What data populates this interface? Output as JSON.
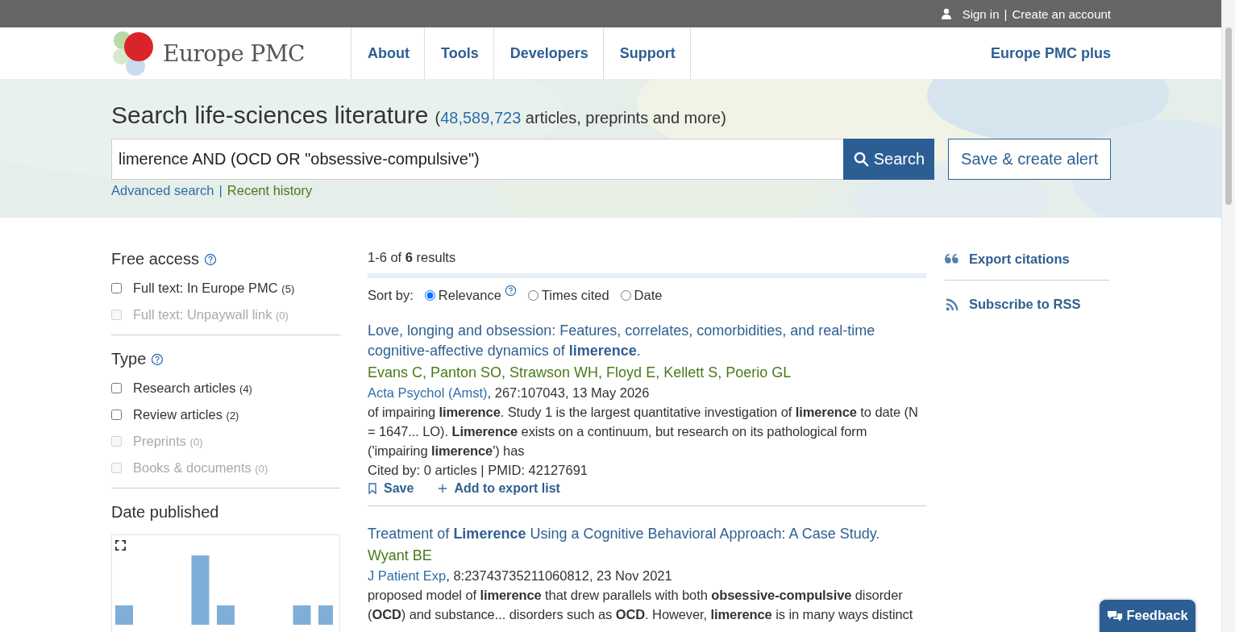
{
  "top_bar": {
    "sign_in": "Sign in",
    "separator": "|",
    "create_account": "Create an account"
  },
  "header": {
    "logo": "Europe PMC",
    "nav": [
      "About",
      "Tools",
      "Developers",
      "Support"
    ],
    "plus_link": "Europe PMC plus"
  },
  "hero": {
    "title": "Search life-sciences literature",
    "count_open": "(",
    "count": "48,589,723",
    "count_rest": "articles, preprints and more)",
    "query": "limerence AND (OCD OR \"obsessive-compulsive\")",
    "search_button": "Search",
    "alert_button": "Save & create alert",
    "advanced": "Advanced search",
    "separator": "|",
    "history": "Recent history"
  },
  "filters": [
    {
      "title": "Free access",
      "help": true,
      "options": [
        {
          "label": "Full text: In Europe PMC",
          "count": "(5)",
          "checked": false,
          "disabled": false
        },
        {
          "label": "Full text: Unpaywall link",
          "count": "(0)",
          "checked": false,
          "disabled": true
        }
      ]
    },
    {
      "title": "Type",
      "help": true,
      "options": [
        {
          "label": "Research articles",
          "count": "(4)",
          "checked": false,
          "disabled": false
        },
        {
          "label": "Review articles",
          "count": "(2)",
          "checked": false,
          "disabled": false
        },
        {
          "label": "Preprints",
          "count": "(0)",
          "checked": false,
          "disabled": true
        },
        {
          "label": "Books & documents",
          "count": "(0)",
          "checked": false,
          "disabled": true
        }
      ]
    }
  ],
  "date_published": {
    "title": "Date published"
  },
  "results": {
    "summary": "1-6 of **6** results",
    "sort_label": "Sort by:",
    "sort_options": [
      {
        "label": "Relevance",
        "selected": true,
        "help": true
      },
      {
        "label": "Times cited",
        "selected": false,
        "help": false
      },
      {
        "label": "Date",
        "selected": false,
        "help": false
      }
    ],
    "items": [
      {
        "title": "Love, longing and obsession: Features, correlates, comorbidities, and real-time cognitive-affective dynamics of **limerence**.",
        "authors": "Evans C, Panton SO, Strawson WH, Floyd E, Kellett S, Poerio GL",
        "journal": "Acta Psychol (Amst)",
        "details": ", 267:107043, 13 May 2026",
        "snippet": "of impairing **limerence**. Study 1 is the largest quantitative investigation of **limerence** to date (N = 1647... LO). **Limerence** exists on a continuum, but research on its pathological form ('impairing **limerence**') has",
        "cited": "Cited by: 0 articles | PMID: 42127691",
        "save": "Save",
        "export": "Add to export list"
      },
      {
        "title": "Treatment of **Limerence** Using a Cognitive Behavioral Approach: A Case Study.",
        "authors": "Wyant BE",
        "journal": "J Patient Exp",
        "details": ", 8:23743735211060812, 23 Nov 2021",
        "snippet": "proposed model of **limerence** that drew parallels with both **obsessive-compulsive** disorder (**OCD**) and substance... disorders such as **OCD**. However, **limerence** is in many ways distinct"
      }
    ]
  },
  "side_actions": [
    "Export citations",
    "Subscribe to RSS"
  ],
  "feedback": "Feedback"
}
